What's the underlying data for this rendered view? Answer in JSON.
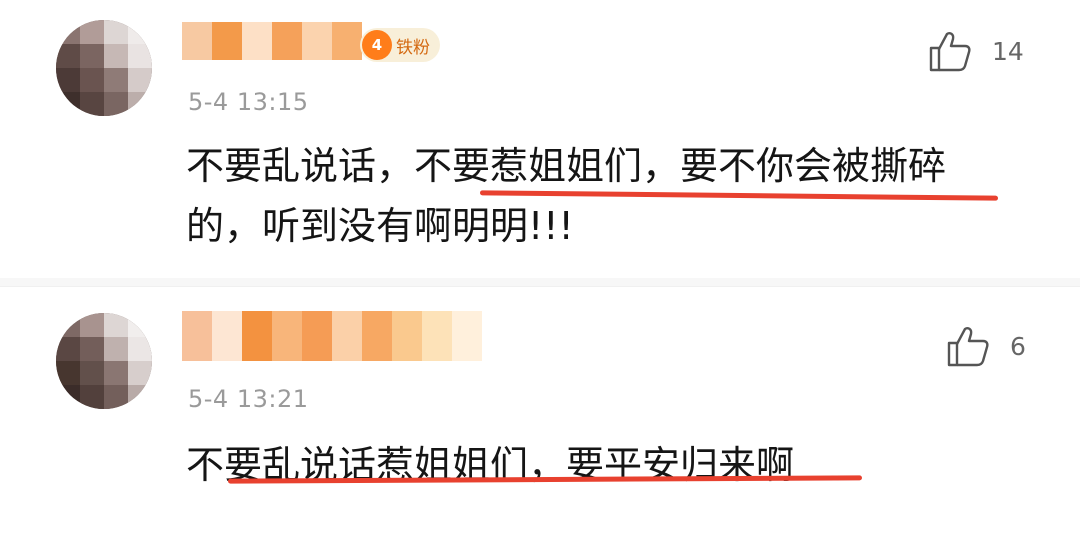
{
  "comments": [
    {
      "badge": {
        "icon_text": "4",
        "label": "铁粉"
      },
      "time": "5-4  13:15",
      "likes": "14",
      "like_icon": "thumbs-up-icon",
      "text_line1": "不要乱说话，不要惹姐姐们，要不你会被撕碎",
      "text_line2": "的，听到没有啊明明!!!"
    },
    {
      "time": "5-4  13:21",
      "likes": "6",
      "like_icon": "thumbs-up-icon",
      "text_line1": "不要乱说话惹姐姐们，要平安归来啊"
    }
  ],
  "colors": {
    "highlight_underline": "#e8412f",
    "name_blur_orange": "#f5a15a",
    "badge_bg": "#f8efd9",
    "badge_text": "#d46a12"
  }
}
